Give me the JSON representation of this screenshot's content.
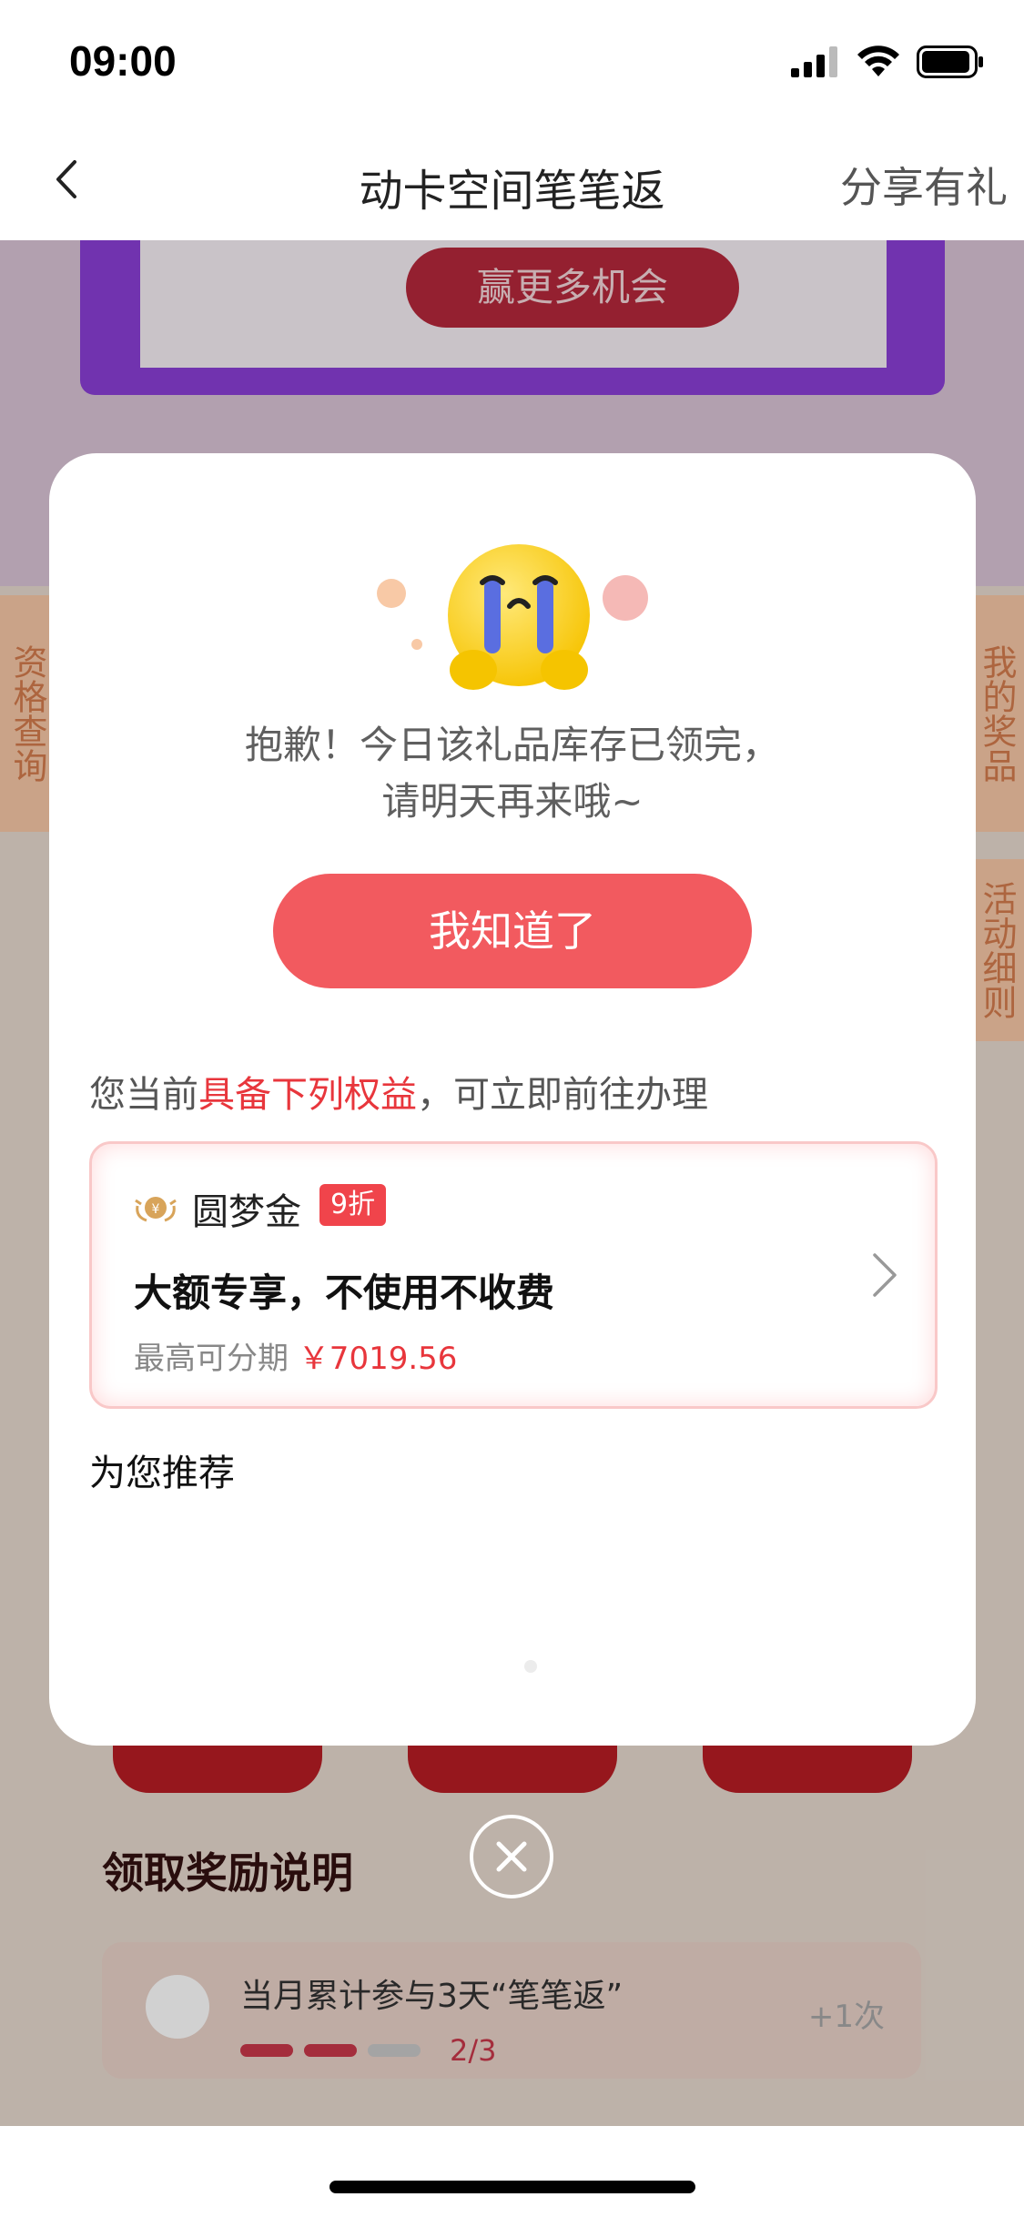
{
  "status_bar": {
    "time": "09:00"
  },
  "nav": {
    "title": "动卡空间笔笔返",
    "share_label": "分享有礼"
  },
  "background": {
    "ticket_button": "赢更多机会",
    "side_tab_left": "资格查询",
    "side_tab_right_1": "我的奖品",
    "side_tab_right_2": "活动细则",
    "section_title": "领取奖励说明",
    "task": {
      "text": "当月累计参与3天“笔笔返”",
      "progress_text": "2/3",
      "progress": {
        "done": 2,
        "total": 3
      },
      "reward": "+1次"
    }
  },
  "modal": {
    "message_line1": "抱歉！今日该礼品库存已领完，",
    "message_line2": "请明天再来哦~",
    "ok_button": "我知道了",
    "benefit_prefix": "您当前",
    "benefit_highlight": "具备下列权益",
    "benefit_suffix": "，可立即前往办理",
    "card": {
      "name": "圆梦金",
      "badge": "9折",
      "title": "大额专享，不使用不收费",
      "sub_label": "最高可分期",
      "amount": "￥7019.56"
    },
    "recommend_title": "为您推荐"
  },
  "colors": {
    "accent": "#f25a5f",
    "highlight": "#e8363c",
    "purple": "#8a3fd6"
  }
}
